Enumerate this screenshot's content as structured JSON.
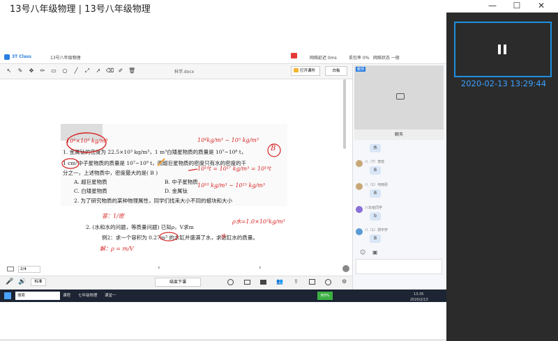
{
  "window": {
    "title": "13号八年级物理 | 13号八年级物理",
    "minimize_glyph": "—",
    "maximize_glyph": "☐",
    "close_glyph": "✕"
  },
  "app": {
    "brand": "3T Class",
    "lesson_tab": "13号八年级物理",
    "network_delay": "网络延迟 0ms",
    "cpu": "丢包率 0%",
    "network_status": "网络状态 一般",
    "doc_tab": "科学.docx",
    "open_file_label": "打开课件",
    "whiteboard_label": "白板",
    "page_indicator": "2/4",
    "send_button": "发送",
    "status_button": "结束下课",
    "handwrite_label": "标准"
  },
  "chat": {
    "header": "聊天",
    "video_label": "教师",
    "messages": [
      {
        "user": "",
        "text": "水"
      },
      {
        "user": "八（7）李晗",
        "text": "B"
      },
      {
        "user": "八（1）何雨彤",
        "text": "B"
      },
      {
        "user": "八年级同学",
        "text": "b"
      },
      {
        "user": "八（1）郭宇轩",
        "text": "B"
      }
    ]
  },
  "document": {
    "question1_line1": "1. 金属钛的密度为 22.5×10³ kg/m³，1 m³白矮星物质的质量是 10⁷~10⁸ t，",
    "question1_line2": "1 cm³中子星物质的质量是 10⁷~10⁹ t，而超巨星物质的密度只有水的密度的千",
    "question1_line3": "分之一，上述物质中，密度最大的是(  B  )",
    "option_a": "A. 超巨星物质",
    "option_b": "B. 中子星物质",
    "option_c": "C. 白矮星物质",
    "option_d": "D. 金属钛",
    "question2": "2. 为了研究物质的某种物理属性，同学们找来大小不同的蜡块和大小",
    "example_line1": "2. (水和水的问题，等质量问题) 已知ρ，V求m",
    "example_line2": "例2：求一个容积为 0.27m³ 的水缸并盛满了水，求这缸水的质量。",
    "ink_top": "10⁴×10³ kg/m³",
    "ink_right1": "10⁴kg/m³ ~ 10⁵ kg/m³",
    "ink_right2": "10¹⁴t = 10¹⁷ kg/m³ = 10¹⁴t",
    "ink_right3": "10¹⁰ kg/m³ ~ 10¹⁵ kg/m³",
    "ink_solve_note": "ρ水=1.0×10³kg/m³",
    "ink_answer": "答：1/密",
    "ink_formula": "解：ρ = m/V",
    "ink_mark_b": "B",
    "ink_mark_water": "水"
  },
  "overlay": {
    "timestamp": "2020-02-13 13:29:44",
    "pause_glyph": "❚❚"
  },
  "taskbar": {
    "items": [
      "搜索",
      "课程",
      "七年级物理",
      "课堂一"
    ],
    "battery": "80%",
    "time": "13:35",
    "date": "2020/2/13"
  }
}
